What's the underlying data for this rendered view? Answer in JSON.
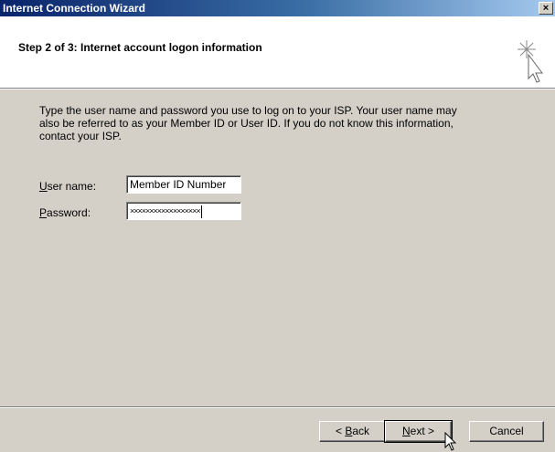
{
  "window": {
    "title": "Internet Connection Wizard",
    "close_glyph": "×"
  },
  "header": {
    "step_title": "Step 2 of 3: Internet account logon information",
    "icon": "wizard-sparkle-cursor-icon"
  },
  "body": {
    "description": "Type the user name and password you use to log on to your ISP. Your user name may also be referred to as your Member ID or User ID. If you do not know this information, contact your ISP.",
    "username": {
      "label_first": "U",
      "label_rest": "ser name:",
      "value": "Member ID Number"
    },
    "password": {
      "label_first": "P",
      "label_rest": "assword:",
      "masked_value": "××××××××××××××××××"
    }
  },
  "buttons": {
    "back": {
      "prefix": "< ",
      "accel": "B",
      "rest": "ack"
    },
    "next": {
      "accel": "N",
      "rest": "ext >"
    },
    "cancel": {
      "label": "Cancel"
    }
  },
  "colors": {
    "titlebar_start": "#0a246a",
    "dialog_bg": "#d4d0c8"
  }
}
